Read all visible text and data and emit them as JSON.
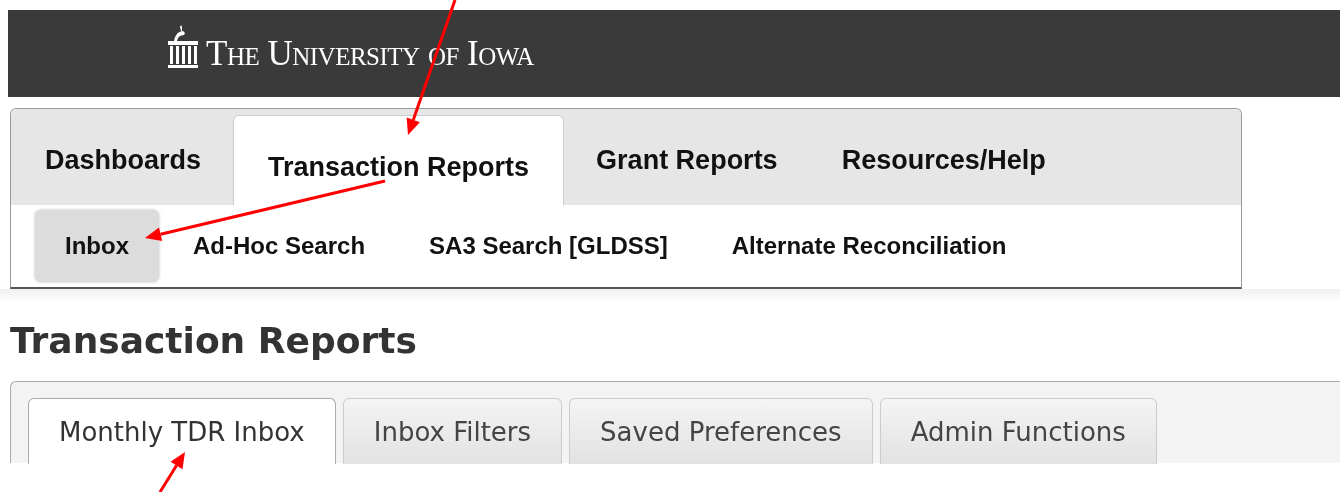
{
  "header": {
    "logo_text": "The University of Iowa"
  },
  "main_tabs": [
    {
      "label": "Dashboards",
      "selected": false
    },
    {
      "label": "Transaction Reports",
      "selected": true
    },
    {
      "label": "Grant Reports",
      "selected": false
    },
    {
      "label": "Resources/Help",
      "selected": false
    }
  ],
  "sub_tabs": [
    {
      "label": "Inbox",
      "selected": true
    },
    {
      "label": "Ad-Hoc Search",
      "selected": false
    },
    {
      "label": "SA3 Search [GLDSS]",
      "selected": false
    },
    {
      "label": "Alternate Reconciliation",
      "selected": false
    }
  ],
  "page_title": "Transaction Reports",
  "content_tabs": [
    {
      "label": "Monthly TDR Inbox",
      "selected": true
    },
    {
      "label": "Inbox Filters",
      "selected": false
    },
    {
      "label": "Saved Preferences",
      "selected": false
    },
    {
      "label": "Admin Functions",
      "selected": false
    }
  ],
  "annotations": [
    {
      "kind": "arrow"
    },
    {
      "kind": "arrow"
    },
    {
      "kind": "arrow"
    }
  ]
}
